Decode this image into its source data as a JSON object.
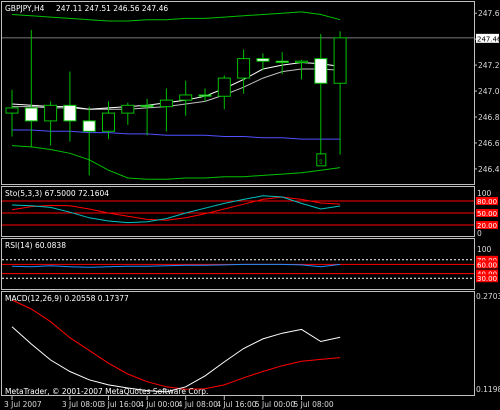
{
  "chart_data": {
    "type": "candlestick",
    "symbol_label": "GBPJPY,H4",
    "ohlc_label": "247.11 247.51 246.56 247.46",
    "x_tick_labels": [
      "3 Jul 2007",
      "3 Jul 08:00",
      "3 Jul 16:00",
      "4 Jul 00:00",
      "4 Jul 08:00",
      "4 Jul 16:00",
      "5 Jul 00:00",
      "5 Jul 08:00"
    ],
    "x_tick_bars": [
      0,
      3,
      5,
      7,
      9,
      11,
      13,
      15
    ],
    "price_axis_ticks": [
      "247.65",
      "247.45",
      "247.25",
      "247.05",
      "246.85",
      "246.65",
      "246.45"
    ],
    "price_range": [
      246.38,
      247.69
    ],
    "current_price": "247.46",
    "candles": [
      {
        "open": 246.88,
        "high": 247.06,
        "low": 246.7,
        "close": 246.92
      },
      {
        "open": 246.92,
        "high": 247.52,
        "low": 246.62,
        "close": 246.82
      },
      {
        "open": 246.82,
        "high": 246.97,
        "low": 246.63,
        "close": 246.94
      },
      {
        "open": 246.94,
        "high": 247.2,
        "low": 246.66,
        "close": 246.82
      },
      {
        "open": 246.82,
        "high": 246.93,
        "low": 246.4,
        "close": 246.74
      },
      {
        "open": 246.74,
        "high": 246.97,
        "low": 246.68,
        "close": 246.88
      },
      {
        "open": 246.88,
        "high": 246.96,
        "low": 246.79,
        "close": 246.94
      },
      {
        "open": 246.94,
        "high": 246.99,
        "low": 246.71,
        "close": 246.93
      },
      {
        "open": 246.93,
        "high": 247.07,
        "low": 246.74,
        "close": 246.98
      },
      {
        "open": 246.98,
        "high": 247.13,
        "low": 246.86,
        "close": 247.02
      },
      {
        "open": 247.02,
        "high": 247.07,
        "low": 246.97,
        "close": 247.01
      },
      {
        "open": 247.01,
        "high": 247.17,
        "low": 246.91,
        "close": 247.15
      },
      {
        "open": 247.15,
        "high": 247.37,
        "low": 247.03,
        "close": 247.3
      },
      {
        "open": 247.3,
        "high": 247.34,
        "low": 247.21,
        "close": 247.28
      },
      {
        "open": 247.28,
        "high": 247.35,
        "low": 247.18,
        "close": 247.27
      },
      {
        "open": 247.27,
        "high": 247.29,
        "low": 247.14,
        "close": 247.28
      },
      {
        "open": 247.3,
        "high": 247.49,
        "low": 246.56,
        "close": 247.11
      },
      {
        "open": 247.11,
        "high": 247.51,
        "low": 246.56,
        "close": 247.46
      }
    ],
    "upper_band": [
      247.64,
      247.63,
      247.62,
      247.61,
      247.6,
      247.59,
      247.59,
      247.6,
      247.6,
      247.61,
      247.61,
      247.62,
      247.63,
      247.64,
      247.65,
      247.66,
      247.64,
      247.6
    ],
    "lower_band": [
      246.63,
      246.62,
      246.6,
      246.57,
      246.52,
      246.44,
      246.38,
      246.37,
      246.37,
      246.38,
      246.38,
      246.39,
      246.39,
      246.4,
      246.41,
      246.42,
      246.44,
      246.46
    ],
    "ma_fast": [
      246.95,
      246.94,
      246.93,
      246.93,
      246.91,
      246.92,
      246.93,
      246.94,
      246.96,
      246.98,
      247.01,
      247.07,
      247.14,
      247.22,
      247.25,
      247.27,
      247.26,
      247.24
    ],
    "ma_slow": [
      246.93,
      246.93,
      246.92,
      246.92,
      246.91,
      246.91,
      246.91,
      246.92,
      246.93,
      246.95,
      246.97,
      247.02,
      247.08,
      247.15,
      247.2,
      247.22,
      247.22,
      247.21
    ],
    "ma_long": [
      246.75,
      246.75,
      246.74,
      246.74,
      246.73,
      246.73,
      246.72,
      246.72,
      246.71,
      246.71,
      246.71,
      246.7,
      246.7,
      246.69,
      246.69,
      246.68,
      246.68,
      246.68
    ],
    "marker_label": "⇧",
    "panels": {
      "stochastic": {
        "label": "Sto(5,3,3) 67.5000 72.1604",
        "axis_ticks": [
          "100",
          "80",
          "50",
          "20",
          "0"
        ],
        "level_tags": [
          "80.00",
          "50.00",
          "20.00"
        ],
        "levels": [
          80,
          50,
          20
        ],
        "range": [
          0,
          100
        ],
        "main": [
          70,
          68,
          64,
          52,
          38,
          30,
          26,
          28,
          36,
          50,
          62,
          74,
          84,
          93,
          90,
          74,
          60,
          67.5
        ],
        "signal": [
          58,
          66,
          69,
          68,
          60,
          50,
          42,
          34,
          32,
          38,
          48,
          60,
          72,
          84,
          90,
          84,
          75,
          72.16
        ]
      },
      "rsi": {
        "label": "RSI(14) 60.0838",
        "axis_ticks": [
          "100",
          "50",
          "0"
        ],
        "level_tags": [
          "70.00",
          "60.00",
          "40.00",
          "30.00"
        ],
        "levels": [
          70,
          60,
          40,
          30
        ],
        "range": [
          0,
          100
        ],
        "values": [
          56,
          55,
          57,
          55,
          54,
          55,
          56,
          56,
          57,
          58,
          58,
          59,
          60,
          60,
          60,
          59,
          55,
          60.08
        ]
      },
      "macd": {
        "label": "MACD(12,26,9) 0.20558 0.17377",
        "axis_ticks": [
          "0.27035",
          "0.1198"
        ],
        "range": [
          0.1198,
          0.27035
        ],
        "main": [
          0.222,
          0.195,
          0.17,
          0.152,
          0.139,
          0.131,
          0.126,
          0.122,
          0.12,
          0.128,
          0.145,
          0.167,
          0.188,
          0.203,
          0.212,
          0.218,
          0.199,
          0.2056
        ],
        "signal": [
          0.264,
          0.25,
          0.23,
          0.205,
          0.185,
          0.165,
          0.148,
          0.136,
          0.128,
          0.124,
          0.125,
          0.131,
          0.142,
          0.152,
          0.161,
          0.168,
          0.171,
          0.1738
        ]
      }
    },
    "copyright": "MetaTrader, © 2001-2007 MetaQuotes Software Corp."
  },
  "colors": {
    "background": "#000000",
    "border": "#bfbfbf",
    "candle_up_fill": "#000000",
    "candle_down_fill": "#ffffff",
    "candle_outline": "#00c000",
    "bands": "#00c000",
    "ma_fast": "#ffffff",
    "ma_slow": "#c0c0c0",
    "ma_long": "#5050ff",
    "price_line": "#a0a0a0",
    "stoch_main": "#00c0c0",
    "stoch_signal": "#ff0000",
    "rsi_line": "#1e90ff",
    "macd_main": "#ffffff",
    "macd_signal": "#ff0000",
    "level_line": "#ff0000",
    "marker": "#00c000"
  }
}
